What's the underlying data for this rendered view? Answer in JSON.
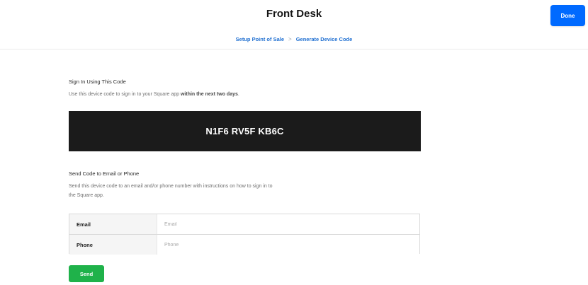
{
  "header": {
    "title": "Front Desk",
    "done_label": "Done"
  },
  "breadcrumb": {
    "items": [
      "Setup Point of Sale",
      "Generate Device Code"
    ],
    "separator": ">"
  },
  "sign_in": {
    "label": "Sign In Using This Code",
    "description_prefix": "Use this device code to sign in to your Square app ",
    "description_bold": "within the next two days",
    "description_suffix": ".",
    "device_code": "N1F6 RV5F KB6C"
  },
  "send_code": {
    "label": "Send Code to Email or Phone",
    "description_line1": "Send this device code to an email and/or phone number with instructions on how to sign in to",
    "description_line2": "the Square app.",
    "fields": {
      "email_label": "Email",
      "email_placeholder": "Email",
      "email_value": "",
      "phone_label": "Phone",
      "phone_placeholder": "Phone",
      "phone_value": ""
    },
    "send_label": "Send"
  },
  "colors": {
    "primary_blue": "#006aff",
    "link_blue": "#1f6fd1",
    "send_green": "#1fb24a",
    "code_box_bg": "#1b1b1b"
  }
}
